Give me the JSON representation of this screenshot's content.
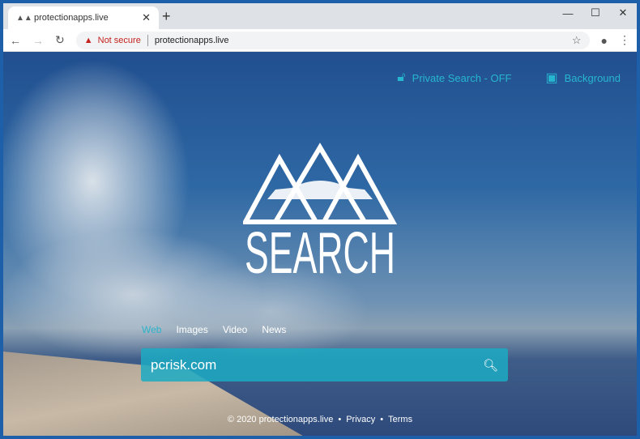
{
  "browser": {
    "tab_title": "protectionapps.live",
    "security_label": "Not secure",
    "url": "protectionapps.live"
  },
  "page": {
    "private_search": "Private Search - OFF",
    "background": "Background",
    "logo_text": "SEARCH",
    "tabs": [
      {
        "label": "Web",
        "active": true
      },
      {
        "label": "Images"
      },
      {
        "label": "Video"
      },
      {
        "label": "News"
      }
    ],
    "search_value": "pcrisk.com",
    "footer": {
      "copyright": "© 2020 protectionapps.live",
      "dot": "•",
      "privacy": "Privacy",
      "terms": "Terms"
    }
  },
  "colors": {
    "accent": "#27b6cf",
    "not_secure": "#c5221f"
  }
}
